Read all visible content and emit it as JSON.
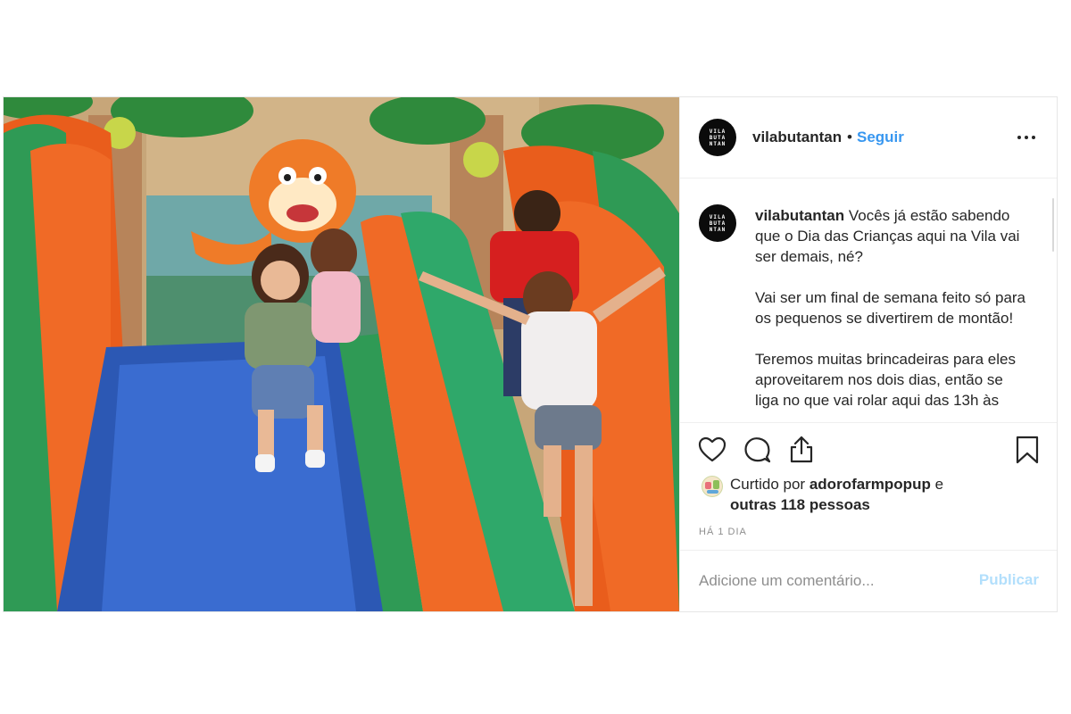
{
  "post": {
    "username": "vilabutantan",
    "separator": "•",
    "follow_label": "Seguir",
    "avatar_text": [
      "VILA",
      "BUTA",
      "NTAN"
    ],
    "more_icon": "more-horizontal-icon"
  },
  "photo": {
    "alt": "Crianças brincando em um escorregador inflável"
  },
  "caption": {
    "username": "vilabutantan",
    "text": "Vocês já estão sabendo que o Dia das Crianças aqui na Vila vai ser demais, né?\n\nVai ser um final de semana feito só para os pequenos se divertirem de montão!\n\nTeremos muitas brincadeiras para eles aproveitarem nos dois dias, então se liga no que vai rolar aqui das 13h às"
  },
  "actions": {
    "like_icon": "heart-icon",
    "comment_icon": "comment-icon",
    "share_icon": "share-icon",
    "save_icon": "bookmark-icon"
  },
  "likes": {
    "prefix": "Curtido por",
    "liker": "adorofarmpopup",
    "conjunction": "e",
    "others": "outras 118 pessoas"
  },
  "timestamp": "HÁ 1 DIA",
  "comment_box": {
    "placeholder": "Adicione um comentário...",
    "publish_label": "Publicar"
  },
  "colors": {
    "accent": "#3897f0",
    "publish_disabled": "#b2dffc",
    "text": "#262626",
    "muted": "#8e8e8e",
    "border": "#efefef"
  }
}
